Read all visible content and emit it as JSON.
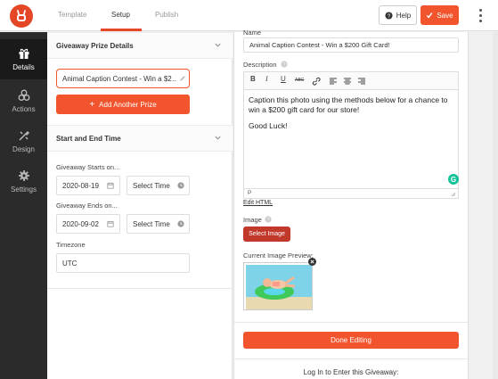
{
  "header": {
    "tabs": [
      {
        "label": "Template"
      },
      {
        "label": "Setup"
      },
      {
        "label": "Publish"
      }
    ],
    "help_label": "Help",
    "save_label": "Save"
  },
  "nav": {
    "items": [
      {
        "label": "Details",
        "icon": "gift-icon"
      },
      {
        "label": "Actions",
        "icon": "actions-icon"
      },
      {
        "label": "Design",
        "icon": "design-icon"
      },
      {
        "label": "Settings",
        "icon": "gear-icon"
      }
    ]
  },
  "prize": {
    "section_title": "Giveaway Prize Details",
    "prize_value": "Animal Caption Contest - Win a $2…",
    "add_label": "Add Another Prize"
  },
  "time": {
    "section_title": "Start and End Time",
    "starts_label": "Giveaway Starts on...",
    "start_date": "2020-08-19",
    "start_time": "Select Time",
    "ends_label": "Giveaway Ends on...",
    "end_date": "2020-09-02",
    "end_time": "Select Time",
    "timezone_label": "Timezone",
    "timezone_value": "UTC"
  },
  "editor": {
    "name_label": "Name",
    "name_value": "Animal Caption Contest - Win a $200 Gift Card!",
    "description_label": "Description",
    "toolbar": [
      "B",
      "I",
      "U",
      "ABC"
    ],
    "body_line1": "Caption this photo using the methods below for a chance to",
    "body_line2": "win a $200 gift card for our store!",
    "body_line3": "Good Luck!",
    "path_label": "P",
    "edit_html": "Edit HTML",
    "image_label": "Image",
    "select_image": "Select Image",
    "current_preview_label": "Current Image Preview:",
    "done_label": "Done Editing",
    "login_text": "Log In to Enter this Giveaway:"
  },
  "colors": {
    "accent": "#f2542d",
    "nav_bg": "#2b2b2b",
    "select_image_bg": "#c0392b"
  }
}
